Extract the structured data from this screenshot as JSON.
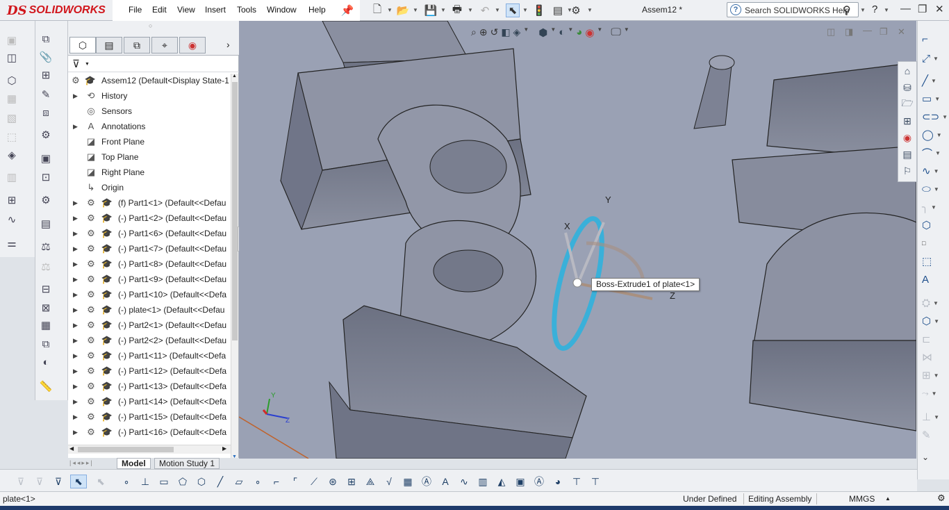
{
  "app": {
    "brand_prefix": "DS",
    "brand": "SOLIDWORKS",
    "doc_title": "Assem12 *"
  },
  "menu": [
    "File",
    "Edit",
    "View",
    "Insert",
    "Tools",
    "Window",
    "Help"
  ],
  "search": {
    "placeholder": "Search SOLIDWORKS Help"
  },
  "help_label": "?",
  "tree": {
    "root": "Assem12  (Default<Display State-1",
    "items": [
      {
        "label": "History",
        "expand": true,
        "icon": "history-icon"
      },
      {
        "label": "Sensors",
        "expand": false,
        "icon": "sensors-icon"
      },
      {
        "label": "Annotations",
        "expand": true,
        "icon": "annotations-icon"
      },
      {
        "label": "Front Plane",
        "expand": false,
        "icon": "plane-icon"
      },
      {
        "label": "Top Plane",
        "expand": false,
        "icon": "plane-icon"
      },
      {
        "label": "Right Plane",
        "expand": false,
        "icon": "plane-icon"
      },
      {
        "label": "Origin",
        "expand": false,
        "icon": "origin-icon"
      },
      {
        "label": "(f) Part1<1> (Default<<Defau",
        "expand": true,
        "icon": "part-icon"
      },
      {
        "label": "(-) Part1<2> (Default<<Defau",
        "expand": true,
        "icon": "part-icon"
      },
      {
        "label": "(-) Part1<6> (Default<<Defau",
        "expand": true,
        "icon": "part-icon"
      },
      {
        "label": "(-) Part1<7> (Default<<Defau",
        "expand": true,
        "icon": "part-icon"
      },
      {
        "label": "(-) Part1<8> (Default<<Defau",
        "expand": true,
        "icon": "part-icon"
      },
      {
        "label": "(-) Part1<9> (Default<<Defau",
        "expand": true,
        "icon": "part-icon"
      },
      {
        "label": "(-) Part1<10> (Default<<Defa",
        "expand": true,
        "icon": "part-icon"
      },
      {
        "label": "(-) plate<1> (Default<<Defau",
        "expand": true,
        "icon": "part-icon"
      },
      {
        "label": "(-) Part2<1> (Default<<Defau",
        "expand": true,
        "icon": "part-icon"
      },
      {
        "label": "(-) Part2<2> (Default<<Defau",
        "expand": true,
        "icon": "part-icon"
      },
      {
        "label": "(-) Part1<11> (Default<<Defa",
        "expand": true,
        "icon": "part-icon"
      },
      {
        "label": "(-) Part1<12> (Default<<Defa",
        "expand": true,
        "icon": "part-icon"
      },
      {
        "label": "(-) Part1<13> (Default<<Defa",
        "expand": true,
        "icon": "part-icon"
      },
      {
        "label": "(-) Part1<14> (Default<<Defa",
        "expand": true,
        "icon": "part-icon"
      },
      {
        "label": "(-) Part1<15> (Default<<Defa",
        "expand": true,
        "icon": "part-icon"
      },
      {
        "label": "(-) Part1<16> (Default<<Defa",
        "expand": true,
        "icon": "part-icon"
      }
    ]
  },
  "bottom_tabs": [
    "Model",
    "Motion Study 1"
  ],
  "viewport": {
    "tooltip": "Boss-Extrude1 of plate<1>",
    "triad": {
      "x": "X",
      "y": "Y",
      "z": "Z"
    },
    "mini_axes": {
      "y": "Y",
      "z": "Z"
    },
    "background": "#9aa1b4",
    "model_color": "#7c8294"
  },
  "status": {
    "selection": "plate<1>",
    "state": "Under Defined",
    "mode": "Editing Assembly",
    "units": "MMGS"
  },
  "colors": {
    "brand": "#d1161c",
    "accent": "#1e4f8c",
    "triad": "#3ab0d9"
  }
}
